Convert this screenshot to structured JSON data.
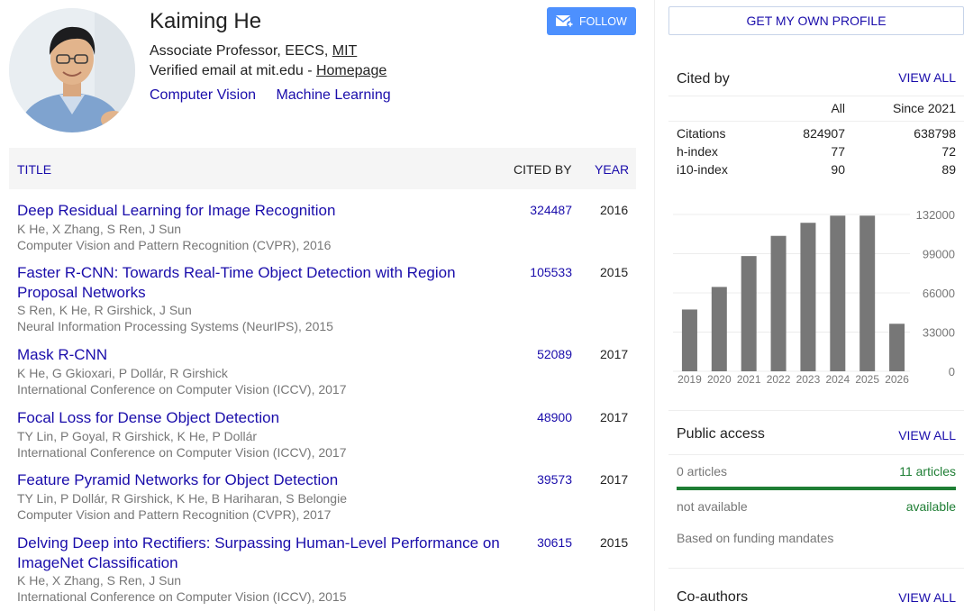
{
  "profile": {
    "name": "Kaiming He",
    "affiliation_prefix": "Associate Professor, EECS, ",
    "affiliation_link": "MIT",
    "email_prefix": "Verified email at mit.edu - ",
    "homepage_label": "Homepage",
    "interests": [
      "Computer Vision",
      "Machine Learning"
    ],
    "follow_label": "FOLLOW",
    "follow_icon": "email-plus-icon"
  },
  "table": {
    "col_title": "TITLE",
    "col_cited_by": "CITED BY",
    "col_year": "YEAR"
  },
  "articles": [
    {
      "title": "Deep Residual Learning for Image Recognition",
      "authors": "K He, X Zhang, S Ren, J Sun",
      "venue": "Computer Vision and Pattern Recognition (CVPR), 2016",
      "cited_by": "324487",
      "year": "2016"
    },
    {
      "title": "Faster R-CNN: Towards Real-Time Object Detection with Region Proposal Networks",
      "authors": "S Ren, K He, R Girshick, J Sun",
      "venue": "Neural Information Processing Systems (NeurIPS), 2015",
      "cited_by": "105533",
      "year": "2015"
    },
    {
      "title": "Mask R-CNN",
      "authors": "K He, G Gkioxari, P Dollár, R Girshick",
      "venue": "International Conference on Computer Vision (ICCV), 2017",
      "cited_by": "52089",
      "year": "2017"
    },
    {
      "title": "Focal Loss for Dense Object Detection",
      "authors": "TY Lin, P Goyal, R Girshick, K He, P Dollár",
      "venue": "International Conference on Computer Vision (ICCV), 2017",
      "cited_by": "48900",
      "year": "2017"
    },
    {
      "title": "Feature Pyramid Networks for Object Detection",
      "authors": "TY Lin, P Dollár, R Girshick, K He, B Hariharan, S Belongie",
      "venue": "Computer Vision and Pattern Recognition (CVPR), 2017",
      "cited_by": "39573",
      "year": "2017"
    },
    {
      "title": "Delving Deep into Rectifiers: Surpassing Human-Level Performance on ImageNet Classification",
      "authors": "K He, X Zhang, S Ren, J Sun",
      "venue": "International Conference on Computer Vision (ICCV), 2015",
      "cited_by": "30615",
      "year": "2015"
    }
  ],
  "sidebar": {
    "get_profile_label": "GET MY OWN PROFILE",
    "cited_by": {
      "title": "Cited by",
      "view_all": "VIEW ALL",
      "col_all": "All",
      "col_since": "Since 2021",
      "rows": [
        {
          "label": "Citations",
          "all": "824907",
          "since": "638798"
        },
        {
          "label": "h-index",
          "all": "77",
          "since": "72"
        },
        {
          "label": "i10-index",
          "all": "90",
          "since": "89"
        }
      ]
    },
    "public_access": {
      "title": "Public access",
      "view_all": "VIEW ALL",
      "left_count": "0 articles",
      "right_count": "11 articles",
      "left_status": "not available",
      "right_status": "available",
      "available_fraction": 1.0,
      "note": "Based on funding mandates"
    },
    "coauthors": {
      "title": "Co-authors",
      "view_all": "VIEW ALL"
    }
  },
  "colors": {
    "link": "#1a0dab",
    "bar": "#777777",
    "follow_bg": "#4d90fe",
    "available_green": "#1e7e34"
  },
  "chart_data": {
    "type": "bar",
    "categories": [
      "2019",
      "2020",
      "2021",
      "2022",
      "2023",
      "2024",
      "2025",
      "2026"
    ],
    "values": [
      52000,
      71000,
      97000,
      114000,
      125000,
      131000,
      131000,
      40000
    ],
    "ylim": [
      0,
      132000
    ],
    "yticks": [
      "132000",
      "99000",
      "66000",
      "33000",
      "0"
    ],
    "grid": true
  }
}
